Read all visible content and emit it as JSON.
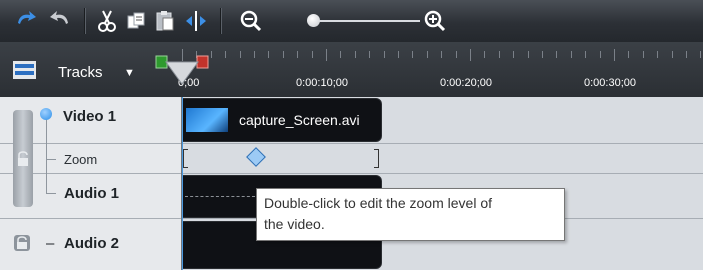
{
  "toolbar": {
    "icons": [
      "undo-icon",
      "redo-icon",
      "cut-icon",
      "copy-icon",
      "paste-icon",
      "split-icon",
      "zoom-out-icon",
      "zoom-slider",
      "zoom-in-icon"
    ]
  },
  "timeline": {
    "tracks_label": "Tracks",
    "caret": "▼",
    "time_labels": [
      "0;00",
      "0:00:10;00",
      "0:00:20;00",
      "0:00:30;00"
    ]
  },
  "tracks": {
    "video1": {
      "name": "Video 1"
    },
    "zoom": {
      "name": "Zoom"
    },
    "audio1": {
      "name": "Audio 1"
    },
    "audio2": {
      "name": "Audio 2",
      "prefix": "–"
    }
  },
  "clips": {
    "video_clip_label": "capture_Screen.avi"
  },
  "tooltip": {
    "line1": "Double-click to edit the zoom level of",
    "line2": "the video."
  },
  "colors": {
    "accent_blue": "#2c8fe8",
    "playhead_green": "#2e9a2e",
    "playhead_red": "#c2332b"
  }
}
